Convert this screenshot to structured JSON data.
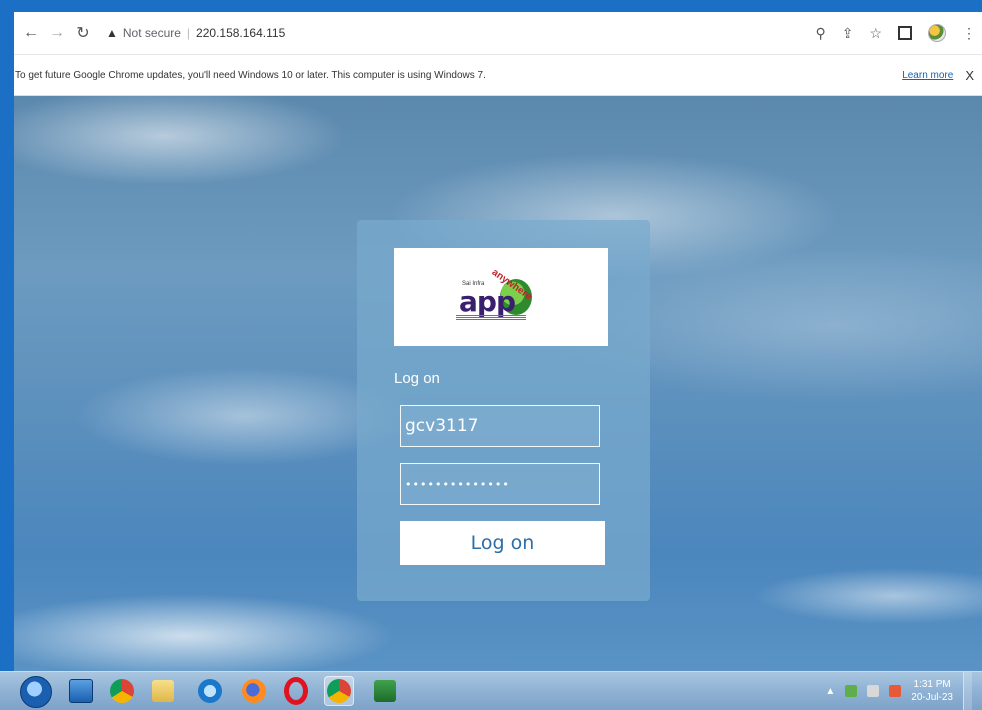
{
  "browser": {
    "security_label": "Not secure",
    "separator": "|",
    "url": "220.158.164.115",
    "icons": [
      "back-icon",
      "forward-icon",
      "reload-icon",
      "warning-icon",
      "zoom-icon",
      "share-icon",
      "bookmark-star-icon",
      "split-view-icon",
      "profile-icon",
      "menu-icon"
    ]
  },
  "infobar": {
    "message": "To get future Google Chrome updates, you'll need Windows 10 or later. This computer is using Windows 7.",
    "learn_more": "Learn more",
    "close": "X"
  },
  "login": {
    "logo_text": "app",
    "logo_small": "Sai Infra",
    "logo_arc": "anywhere",
    "title": "Log on",
    "username_value": "gcv3117",
    "password_value": "••••••••••••••",
    "submit_label": "Log on"
  },
  "taskbar": {
    "apps": [
      "start-orb",
      "lock-app",
      "chrome-app",
      "file-explorer-app",
      "internet-explorer-app",
      "firefox-app",
      "opera-app",
      "chrome-active-app",
      "excel-app"
    ],
    "clock_time": "1:31 PM",
    "clock_date": "20-Jul-23",
    "tray_arrow": "▲"
  },
  "colors": {
    "frame_blue": "#1b6fc4",
    "button_text": "#2e6ea6",
    "link": "#1a5fb4"
  }
}
